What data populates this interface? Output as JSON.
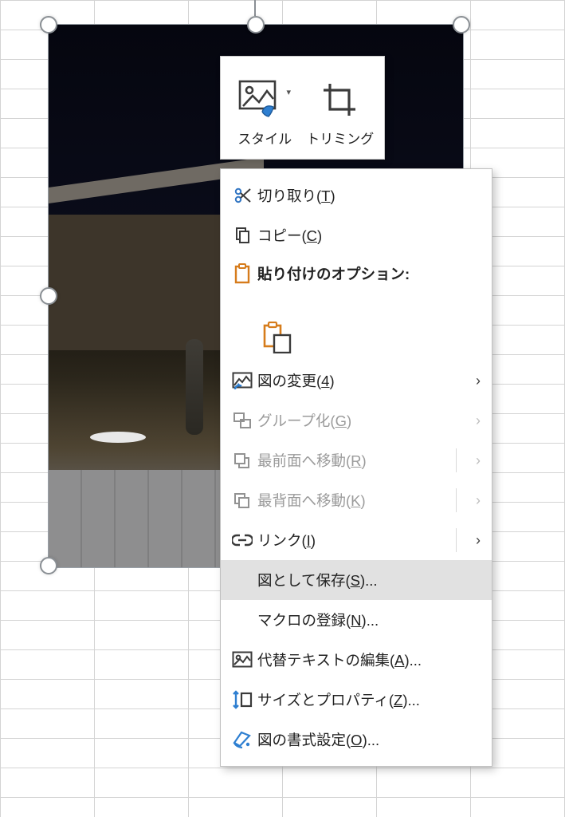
{
  "mini_toolbar": {
    "style_label": "スタイル",
    "crop_label": "トリミング"
  },
  "menu": {
    "cut": {
      "label": "切り取り(",
      "key": "T",
      "tail": ")"
    },
    "copy": {
      "label": "コピー(",
      "key": "C",
      "tail": ")"
    },
    "paste_opts": {
      "label": "貼り付けのオプション:"
    },
    "change_pic": {
      "label": "図の変更(",
      "key": "4",
      "tail": ")"
    },
    "group": {
      "label": "グループ化(",
      "key": "G",
      "tail": ")"
    },
    "bring_front": {
      "label": "最前面へ移動(",
      "key": "R",
      "tail": ")"
    },
    "send_back": {
      "label": "最背面へ移動(",
      "key": "K",
      "tail": ")"
    },
    "link": {
      "label": "リンク(",
      "key": "I",
      "tail": ")"
    },
    "save_as_pic": {
      "label": "図として保存(",
      "key": "S",
      "tail": ")..."
    },
    "assign_macro": {
      "label": "マクロの登録(",
      "key": "N",
      "tail": ")..."
    },
    "alt_text": {
      "label": "代替テキストの編集(",
      "key": "A",
      "tail": ")..."
    },
    "size_props": {
      "label": "サイズとプロパティ(",
      "key": "Z",
      "tail": ")..."
    },
    "format_pic": {
      "label": "図の書式設定(",
      "key": "O",
      "tail": ")..."
    }
  }
}
